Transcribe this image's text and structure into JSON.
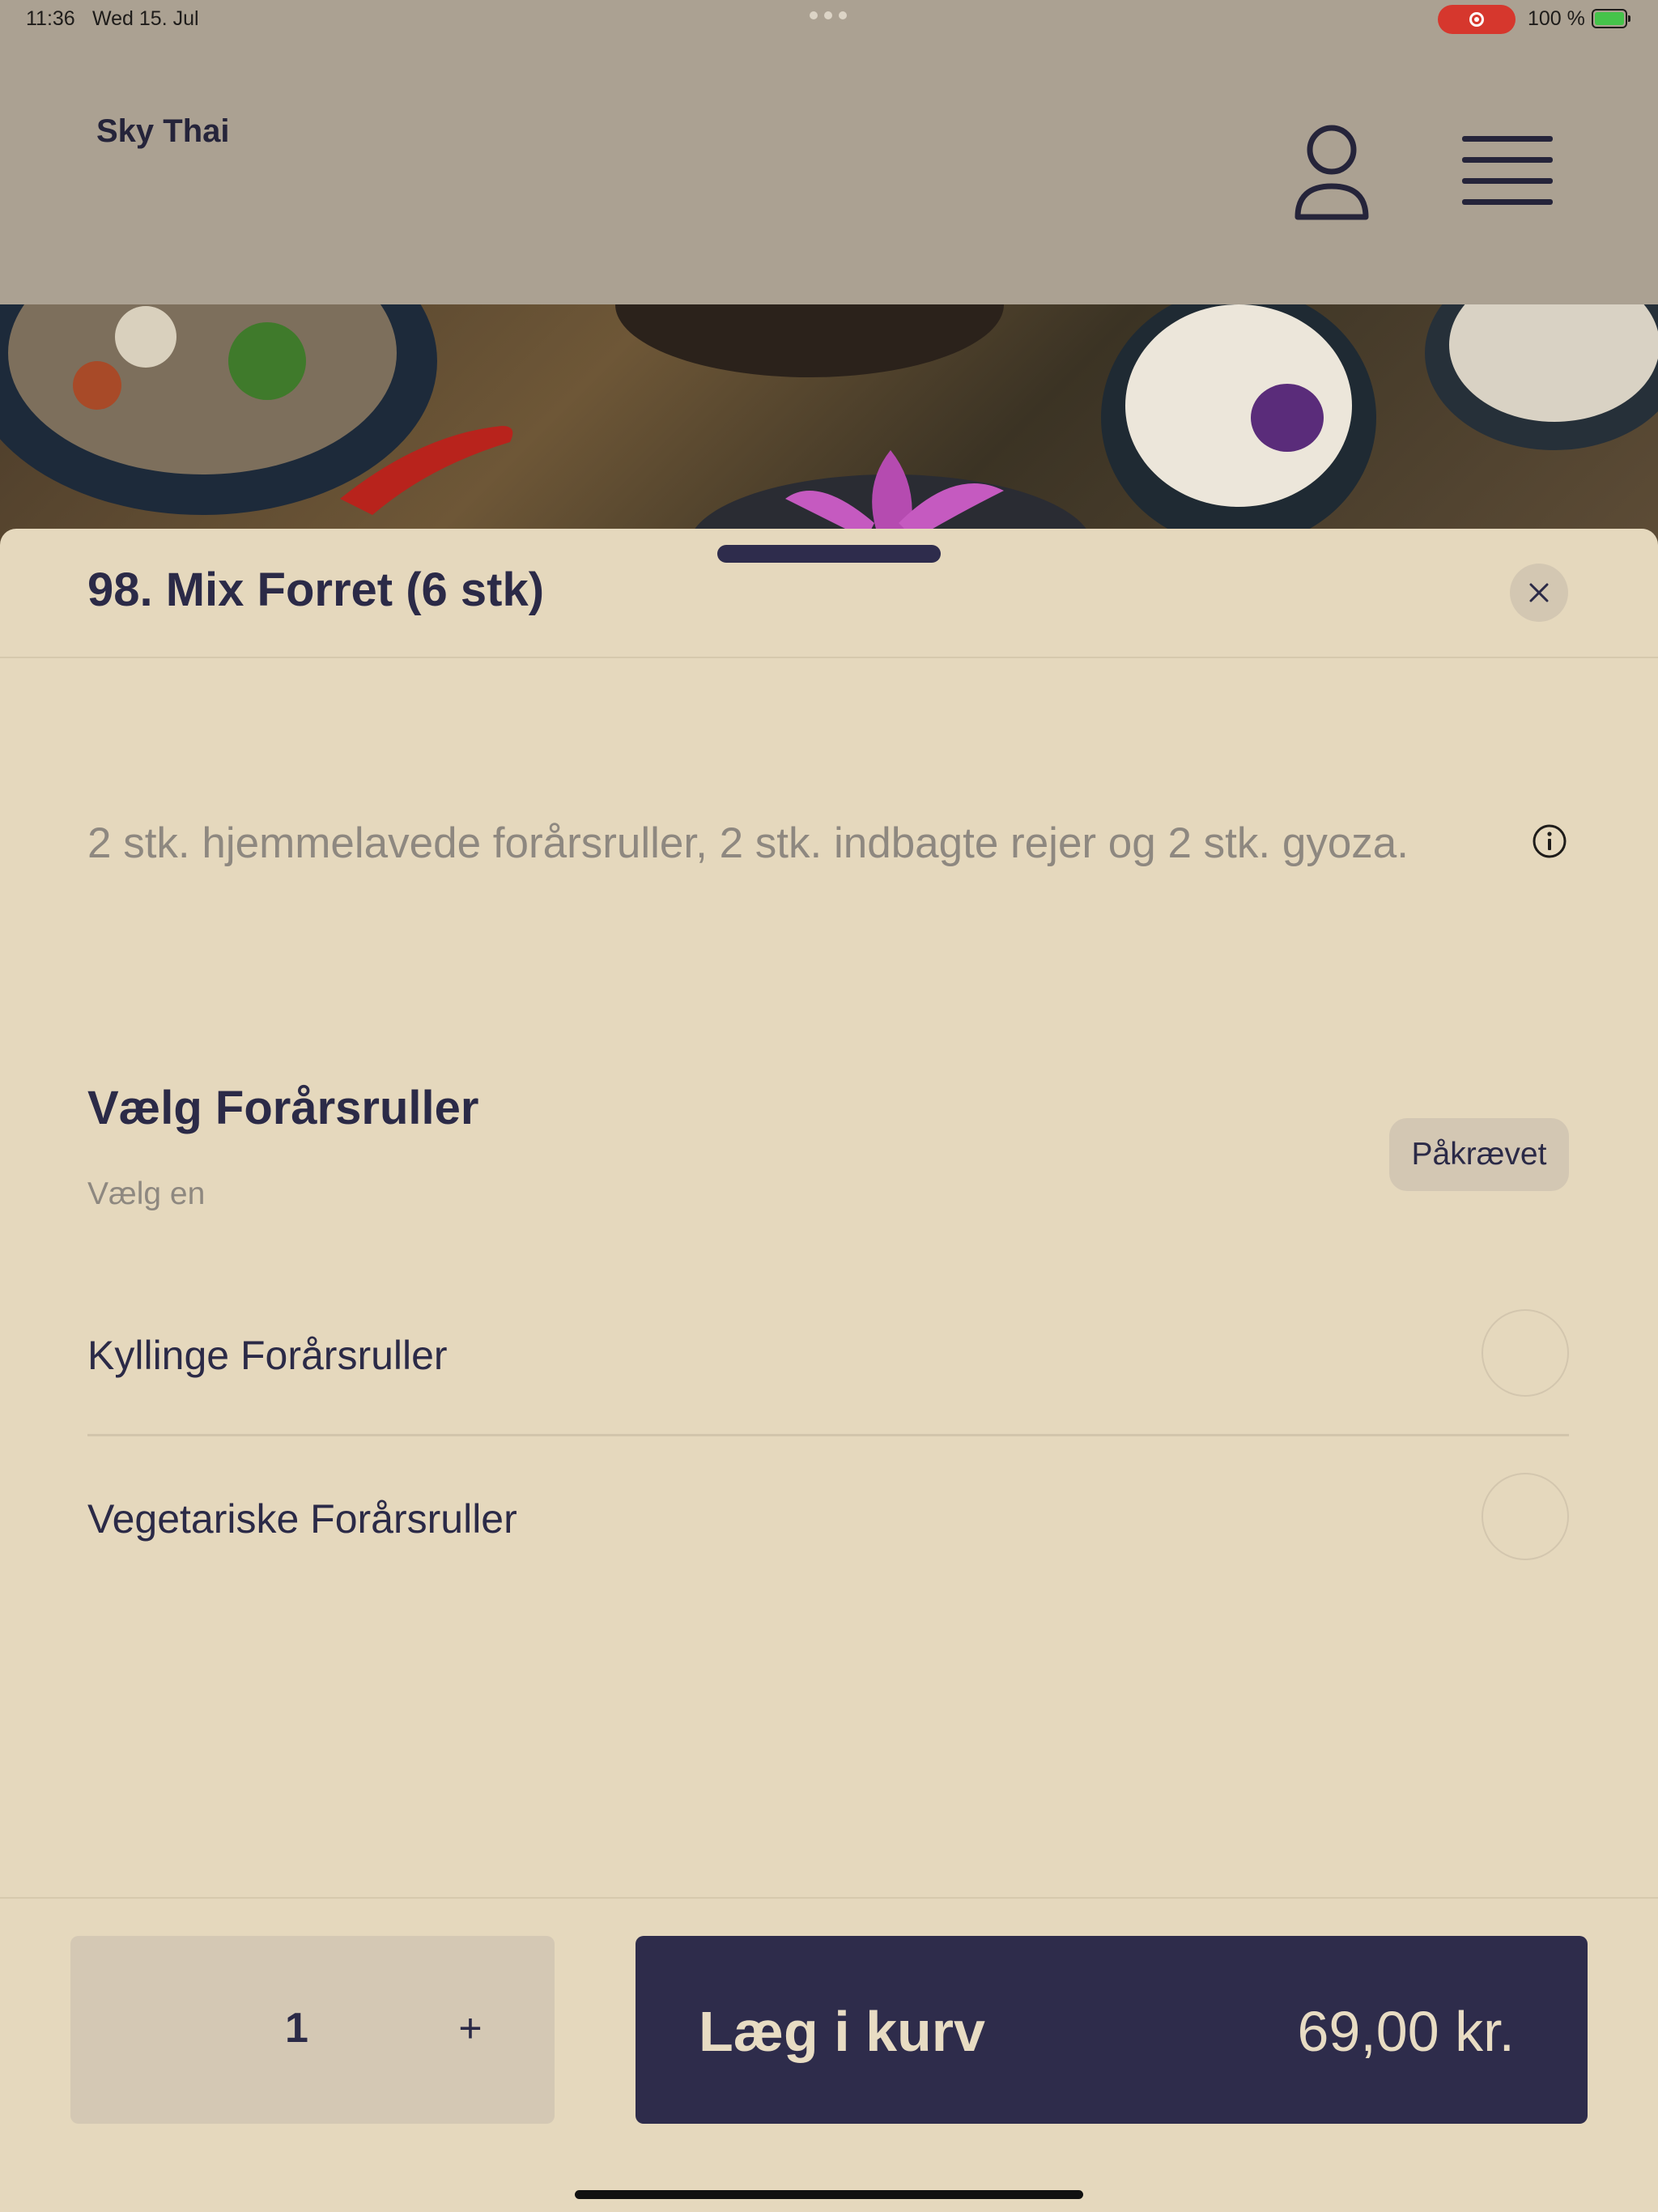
{
  "status_bar": {
    "time": "11:36",
    "date": "Wed 15. Jul",
    "battery": "100 %"
  },
  "header": {
    "brand": "Sky Thai",
    "icons": [
      "user-icon",
      "hamburger-menu-icon"
    ]
  },
  "modal": {
    "title": "98. Mix Forret (6 stk)",
    "description": "2 stk. hjemmelavede forårsruller, 2 stk. indbagte rejer og 2 stk. gyoza.",
    "group": {
      "title": "Vælg Forårsruller",
      "subtitle": "Vælg en",
      "badge": "Påkrævet",
      "options": [
        {
          "label": "Kyllinge Forårsruller",
          "selected": false
        },
        {
          "label": "Vegetariske Forårsruller",
          "selected": false
        }
      ]
    }
  },
  "footer": {
    "quantity": "1",
    "plus": "+",
    "add_label": "Læg i kurv",
    "price": "69,00 kr."
  },
  "colors": {
    "primary": "#2e2c4b",
    "sheet_background": "#e5d8bd",
    "muted_text": "#8e8880",
    "recording": "#d6372d",
    "battery": "#45c34a"
  }
}
